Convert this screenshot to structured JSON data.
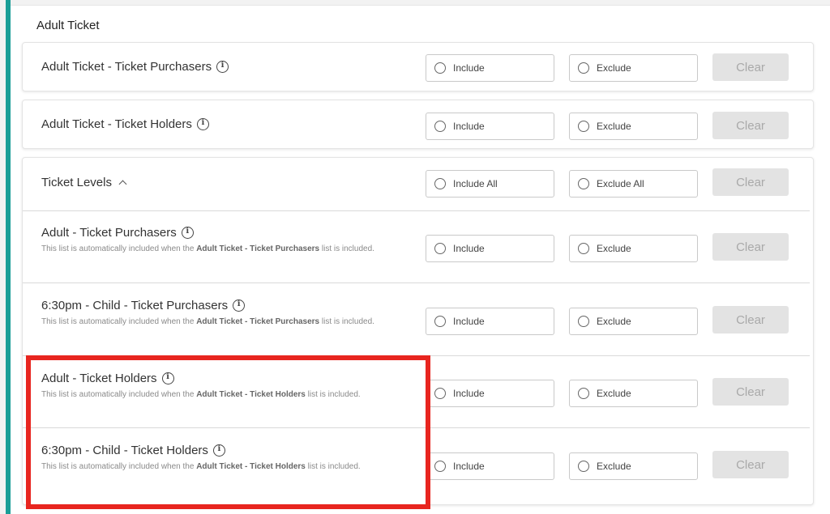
{
  "section": {
    "title": "Adult Ticket"
  },
  "top_rows": [
    {
      "title": "Adult Ticket - Ticket Purchasers",
      "include_label": "Include",
      "exclude_label": "Exclude",
      "clear_label": "Clear"
    },
    {
      "title": "Adult Ticket - Ticket Holders",
      "include_label": "Include",
      "exclude_label": "Exclude",
      "clear_label": "Clear"
    }
  ],
  "ticket_levels": {
    "title": "Ticket Levels",
    "include_label": "Include All",
    "exclude_label": "Exclude All",
    "clear_label": "Clear",
    "rows": [
      {
        "title": "Adult - Ticket Purchasers",
        "desc_prefix": "This list is automatically included when the ",
        "desc_bold": "Adult Ticket - Ticket Purchasers",
        "desc_suffix": " list is included.",
        "include_label": "Include",
        "exclude_label": "Exclude",
        "clear_label": "Clear"
      },
      {
        "title": "6:30pm - Child - Ticket Purchasers",
        "desc_prefix": "This list is automatically included when the ",
        "desc_bold": "Adult Ticket - Ticket Purchasers",
        "desc_suffix": " list is included.",
        "include_label": "Include",
        "exclude_label": "Exclude",
        "clear_label": "Clear"
      },
      {
        "title": "Adult - Ticket Holders",
        "desc_prefix": "This list is automatically included when the ",
        "desc_bold": "Adult Ticket - Ticket Holders",
        "desc_suffix": " list is included.",
        "include_label": "Include",
        "exclude_label": "Exclude",
        "clear_label": "Clear"
      },
      {
        "title": "6:30pm - Child - Ticket Holders",
        "desc_prefix": "This list is automatically included when the ",
        "desc_bold": "Adult Ticket - Ticket Holders",
        "desc_suffix": " list is included.",
        "include_label": "Include",
        "exclude_label": "Exclude",
        "clear_label": "Clear"
      }
    ]
  },
  "colors": {
    "accent": "#1a9e97",
    "highlight": "#e8251f",
    "clear_bg": "#e3e3e3"
  }
}
